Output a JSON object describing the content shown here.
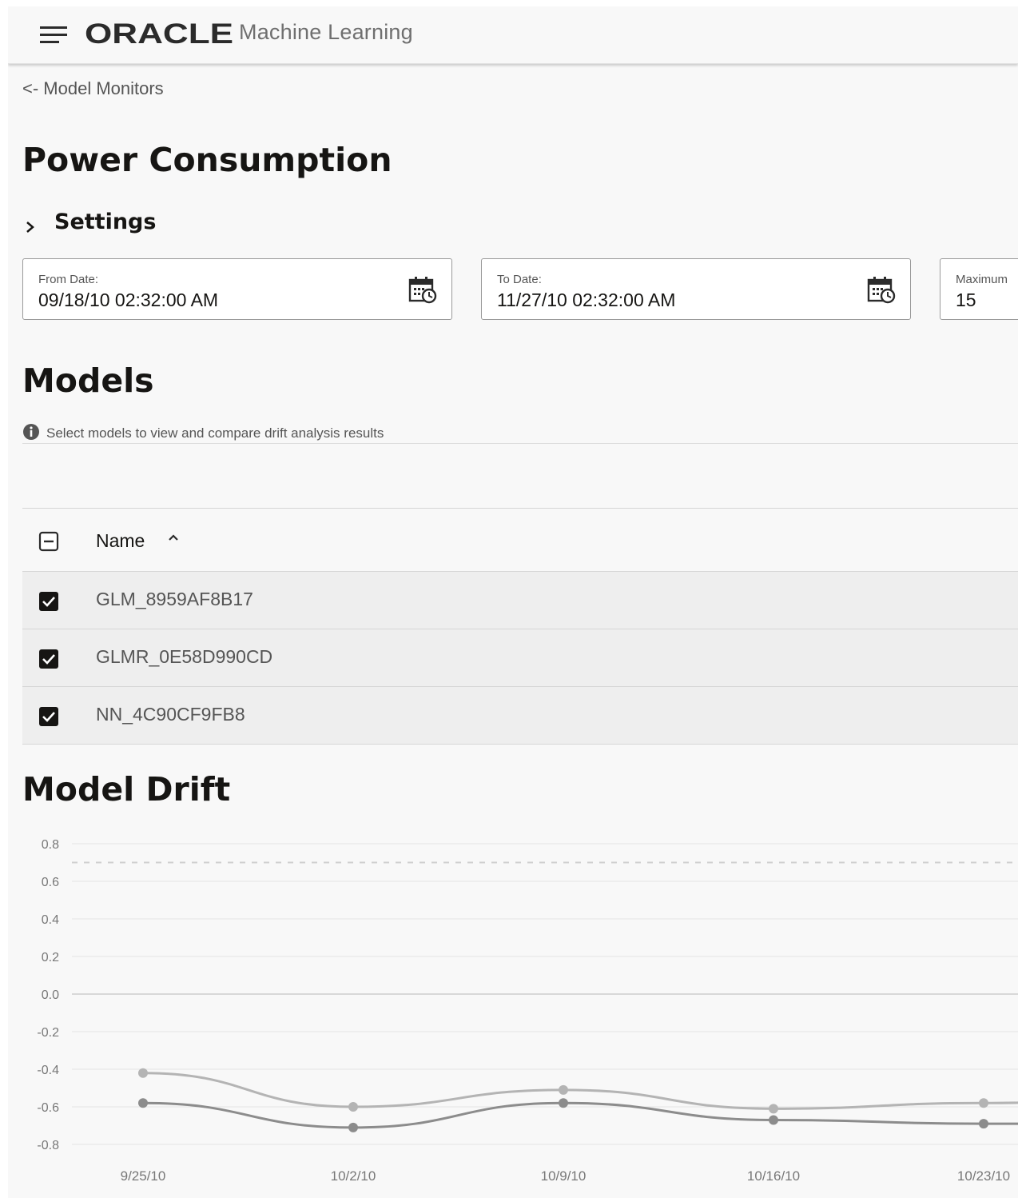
{
  "header": {
    "menu_icon": "hamburger-menu-icon",
    "brand": "ORACLE",
    "product": "Machine Learning"
  },
  "back_link": "<- Model Monitors",
  "page_title": "Power Consumption",
  "settings": {
    "label": "Settings",
    "icon": "chevron-right-icon"
  },
  "fields": {
    "from": {
      "label": "From Date:",
      "value": "09/18/10 02:32:00 AM",
      "icon": "calendar-clock-icon"
    },
    "to": {
      "label": "To Date:",
      "value": "11/27/10 02:32:00 AM",
      "icon": "calendar-clock-icon"
    },
    "maximum": {
      "label": "Maximum",
      "value": "15"
    }
  },
  "models": {
    "heading": "Models",
    "info_text": "Select models to view and compare drift analysis results",
    "info_icon": "info-icon",
    "column_name": "Name",
    "sort_icon": "sort-ascending-icon",
    "rows": [
      {
        "name": "GLM_8959AF8B17",
        "checked": true
      },
      {
        "name": "GLMR_0E58D990CD",
        "checked": true
      },
      {
        "name": "NN_4C90CF9FB8",
        "checked": true
      }
    ]
  },
  "drift": {
    "heading": "Model Drift"
  },
  "colors": {
    "background": "#f8f8f8",
    "row": "#eeeeee",
    "series_light": "#b4b4b4",
    "series_dark": "#8c8c8c",
    "threshold": "#d0d0d0"
  },
  "chart_data": {
    "type": "line",
    "x": [
      "9/25/10",
      "10/2/10",
      "10/9/10",
      "10/16/10",
      "10/23/10"
    ],
    "series": [
      {
        "values": [
          -0.42,
          -0.6,
          -0.51,
          -0.61,
          -0.58
        ]
      },
      {
        "values": [
          -0.58,
          -0.71,
          -0.58,
          -0.67,
          -0.69
        ]
      }
    ],
    "threshold": 0.7,
    "ylim": [
      -0.8,
      0.8
    ],
    "yticks": [
      0.8,
      0.6,
      0.4,
      0.2,
      0.0,
      -0.2,
      -0.4,
      -0.6,
      -0.8
    ],
    "ytick_labels": [
      "0.8",
      "0.6",
      "0.4",
      "0.2",
      "0.0",
      "-0.2",
      "-0.4",
      "-0.6",
      "-0.8"
    ],
    "grid": true,
    "xlabel": "",
    "ylabel": ""
  }
}
